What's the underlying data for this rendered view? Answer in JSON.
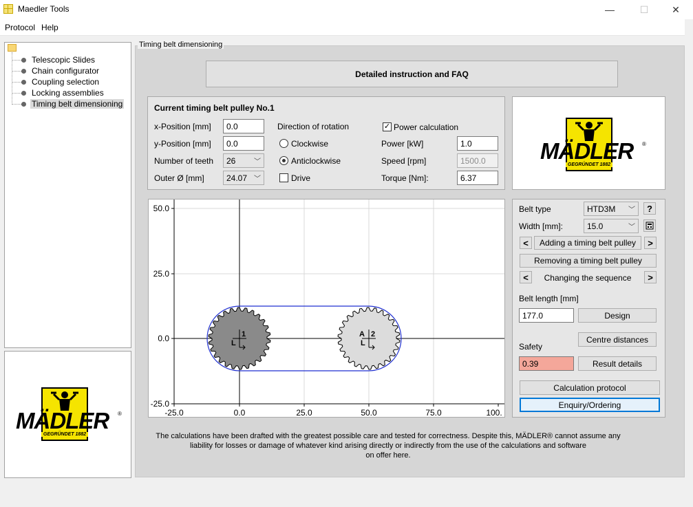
{
  "window": {
    "title": "Maedler Tools",
    "minimize": "—",
    "maximize": "☐",
    "close": "✕"
  },
  "menu": {
    "items": [
      "Protocol",
      "Help"
    ]
  },
  "tree": {
    "items": [
      "Telescopic Slides",
      "Chain configurator",
      "Coupling selection",
      "Locking assemblies",
      "Timing belt dimensioning"
    ],
    "selected_index": 4
  },
  "logo": {
    "word": "MÄDLER",
    "registered": "®",
    "sub": "GEGRÜNDET 1882"
  },
  "main": {
    "group_label": "Timing belt dimensioning",
    "faq_button": "Detailed instruction and FAQ"
  },
  "pulley": {
    "heading": "Current timing belt pulley No.",
    "number": "1",
    "x_label": "x-Position [mm]",
    "x_value": "0.0",
    "y_label": "y-Position [mm]",
    "y_value": "0.0",
    "teeth_label": "Number of teeth",
    "teeth_value": "26",
    "outer_label": "Outer Ø [mm]",
    "outer_value": "24.07",
    "direction_label": "Direction of rotation",
    "clockwise": "Clockwise",
    "anticlockwise": "Anticlockwise",
    "drive": "Drive",
    "power_calc": "Power calculation",
    "power_label": "Power [kW]",
    "power_value": "1.0",
    "speed_label": "Speed [rpm]",
    "speed_value": "1500.0",
    "torque_label": "Torque [Nm]:",
    "torque_value": "6.37"
  },
  "controls": {
    "belt_type_label": "Belt type",
    "belt_type_value": "HTD3M",
    "help": "?",
    "width_label": "Width [mm]:",
    "width_value": "15.0",
    "prev": "<",
    "next": ">",
    "add_pulley": "Adding a timing belt pulley",
    "remove_pulley": "Removing a timing belt pulley",
    "change_sequence": "Changing the sequence",
    "belt_length_label": "Belt length [mm]",
    "belt_length_value": "177.0",
    "design": "Design",
    "centre_distances": "Centre distances",
    "safety_label": "Safety",
    "safety_value": "0.39",
    "result_details": "Result details",
    "calc_protocol": "Calculation protocol",
    "enquiry": "Enquiry/Ordering"
  },
  "plot": {
    "x_ticks": [
      "-25.0",
      "0.0",
      "25.0",
      "50.0",
      "75.0",
      "100."
    ],
    "y_ticks": [
      "50.0",
      "25.0",
      "0.0",
      "-25.0"
    ],
    "pulleys": [
      {
        "label_num": "1",
        "label_dir": "L",
        "label_a": ""
      },
      {
        "label_num": "2",
        "label_dir": "L",
        "label_a": "A"
      }
    ]
  },
  "disclaimer": {
    "line1": "The calculations have been drafted with the greatest possible care and tested for correctness. Despite this, MÄDLER® cannot assume any",
    "line2": "liability for losses or damage of whatever kind arising directly or indirectly from the use of the calculations and software",
    "line3": "on offer here."
  },
  "colors": {
    "belt": "#1f2fd0",
    "pulley_drive": "#8a8a8a",
    "pulley_idle": "#dcdcdc",
    "safety_bad": "#f4a79a",
    "logo_yellow": "#f5e400"
  }
}
